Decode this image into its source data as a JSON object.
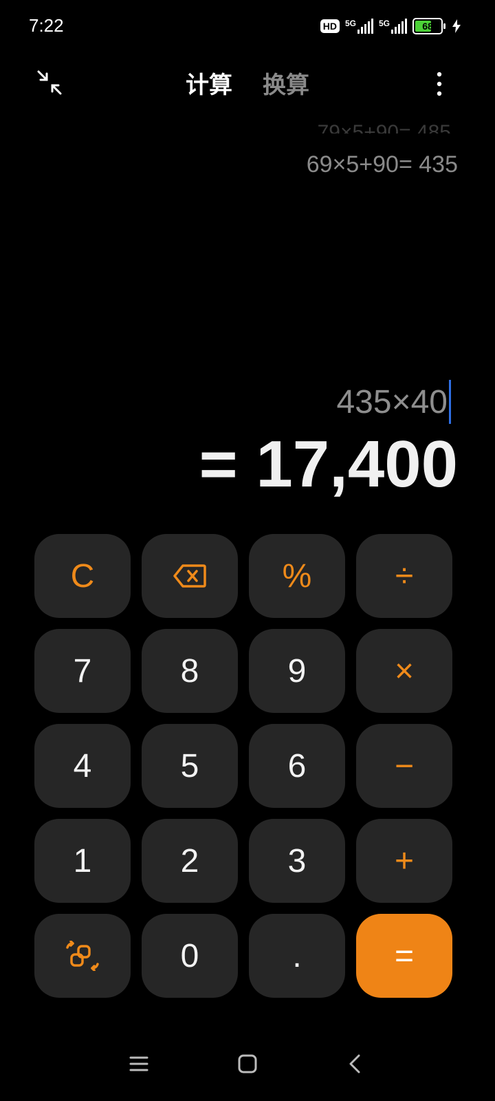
{
  "status_bar": {
    "time": "7:22",
    "hd_label": "HD",
    "network_1": "5G",
    "network_2": "5G",
    "battery_percent": "68",
    "battery_level": 0.68
  },
  "top_nav": {
    "tabs": [
      {
        "label": "计算",
        "active": true
      },
      {
        "label": "换算",
        "active": false
      }
    ]
  },
  "display": {
    "history_faded": "79×5+90= 485",
    "history": "69×5+90= 435",
    "expression": "435×40",
    "result": "= 17,400"
  },
  "keypad": {
    "rows": [
      [
        {
          "label": "C",
          "name": "clear-button",
          "kind": "op"
        },
        {
          "label": "",
          "name": "backspace-button",
          "kind": "op",
          "icon": "backspace-icon"
        },
        {
          "label": "%",
          "name": "percent-button",
          "kind": "op"
        },
        {
          "label": "÷",
          "name": "divide-button",
          "kind": "op"
        }
      ],
      [
        {
          "label": "7",
          "name": "digit-7-button",
          "kind": "num"
        },
        {
          "label": "8",
          "name": "digit-8-button",
          "kind": "num"
        },
        {
          "label": "9",
          "name": "digit-9-button",
          "kind": "num"
        },
        {
          "label": "×",
          "name": "multiply-button",
          "kind": "op"
        }
      ],
      [
        {
          "label": "4",
          "name": "digit-4-button",
          "kind": "num"
        },
        {
          "label": "5",
          "name": "digit-5-button",
          "kind": "num"
        },
        {
          "label": "6",
          "name": "digit-6-button",
          "kind": "num"
        },
        {
          "label": "−",
          "name": "minus-button",
          "kind": "op"
        }
      ],
      [
        {
          "label": "1",
          "name": "digit-1-button",
          "kind": "num"
        },
        {
          "label": "2",
          "name": "digit-2-button",
          "kind": "num"
        },
        {
          "label": "3",
          "name": "digit-3-button",
          "kind": "num"
        },
        {
          "label": "+",
          "name": "plus-button",
          "kind": "op"
        }
      ],
      [
        {
          "label": "",
          "name": "scientific-toggle-button",
          "kind": "op",
          "icon": "swap-icon"
        },
        {
          "label": "0",
          "name": "digit-0-button",
          "kind": "num"
        },
        {
          "label": ".",
          "name": "decimal-button",
          "kind": "num"
        },
        {
          "label": "=",
          "name": "equals-button",
          "kind": "eq"
        }
      ]
    ]
  },
  "colors": {
    "background": "#000000",
    "key_background": "#262626",
    "accent": "#ef8416",
    "cursor": "#2f6fe4"
  }
}
